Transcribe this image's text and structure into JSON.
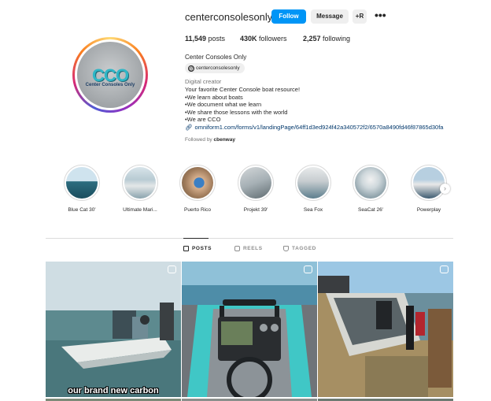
{
  "profile": {
    "username": "centerconsolesonly",
    "follow_label": "Follow",
    "message_label": "Message",
    "add_user_label": "+R",
    "more_label": "•••",
    "avatar_logo_text": "CCO",
    "avatar_logo_sub": "Center Consoles Only",
    "stats": {
      "posts_count": "11,549",
      "posts_label": "posts",
      "followers_count": "430K",
      "followers_label": "followers",
      "following_count": "2,257",
      "following_label": "following"
    },
    "full_name": "Center Consoles Only",
    "threads_handle": "centerconsolesonly",
    "category": "Digital creator",
    "bio_lines": [
      "Your favorite Center Console boat resource!",
      "•We learn about boats",
      "•We document what we learn",
      "•We share those lessons with the world",
      "•We are CCO"
    ],
    "link": "omniform1.com/forms/v1/landingPage/64ff1d3ed924f42a340572f2/6570a8490fd46f87865d30fa",
    "followed_by_prefix": "Followed by",
    "followed_by_name": "cbenway"
  },
  "highlights": [
    {
      "label": "Blue Cat 30'"
    },
    {
      "label": "Ultimate Mari..."
    },
    {
      "label": "Puerto Rico"
    },
    {
      "label": "Projekt 39'"
    },
    {
      "label": "Sea Fox"
    },
    {
      "label": "SeaCat 26'"
    },
    {
      "label": "Powerplay"
    }
  ],
  "tabs": [
    {
      "label": "POSTS",
      "active": true
    },
    {
      "label": "REELS",
      "active": false
    },
    {
      "label": "TAGGED",
      "active": false
    }
  ],
  "posts": [
    {
      "caption": "our brand new carbon",
      "type": "reel"
    },
    {
      "caption": "",
      "type": "reel"
    },
    {
      "caption": "",
      "type": "reel"
    }
  ],
  "colors": {
    "accent": "#0095f6",
    "link": "#00376b",
    "muted": "#737373"
  }
}
